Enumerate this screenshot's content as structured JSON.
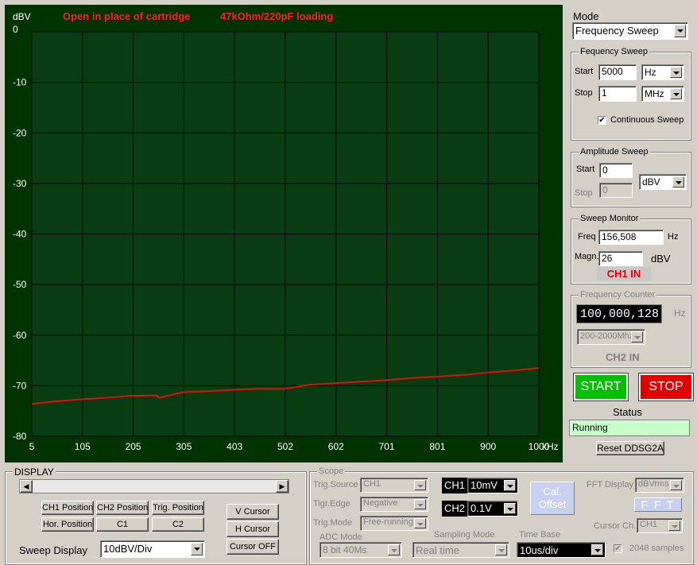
{
  "chart": {
    "title": "Open in place of cartridge",
    "subtitle": "47kOhm/220pF loading",
    "y_unit": "dBV",
    "x_unit": "kHz"
  },
  "chart_data": {
    "type": "line",
    "title": "Open in place of cartridge",
    "ylabel": "dBV",
    "xlabel": "kHz",
    "x_ticks": [
      "5",
      "105",
      "205",
      "305",
      "403",
      "502",
      "602",
      "701",
      "801",
      "900",
      "1000"
    ],
    "y_ticks": [
      "0",
      "-10",
      "-20",
      "-30",
      "-40",
      "-50",
      "-60",
      "-70",
      "-80"
    ],
    "ylim": [
      -80,
      0
    ],
    "xlim": [
      5,
      1000
    ],
    "grid": true,
    "series": [
      {
        "color": "#e01010",
        "x": [
          5,
          50,
          100,
          150,
          200,
          250,
          255,
          300,
          350,
          400,
          450,
          502,
          550,
          600,
          650,
          700,
          750,
          800,
          850,
          900,
          950,
          1000
        ],
        "y": [
          -73.6,
          -73.1,
          -72.7,
          -72.4,
          -72.0,
          -71.9,
          -72.4,
          -71.3,
          -71.1,
          -70.8,
          -70.6,
          -70.6,
          -69.8,
          -69.5,
          -69.2,
          -68.9,
          -68.5,
          -68.2,
          -67.9,
          -67.4,
          -67.0,
          -66.5
        ]
      }
    ]
  },
  "mode": {
    "label": "Mode",
    "value": "Frequency Sweep"
  },
  "freq_sweep": {
    "title": "Fequency Sweep",
    "start_label": "Start",
    "start_value": "5000",
    "start_unit": "Hz",
    "stop_label": "Stop",
    "stop_value": "1",
    "stop_unit": "MHz",
    "continuous_label": "Continuous Sweep",
    "continuous_mark": "✔"
  },
  "amp_sweep": {
    "title": "Amplitude Sweep",
    "start_label": "Start",
    "start_value": "0",
    "stop_label": "Stop",
    "stop_value": "0",
    "unit": "dBV"
  },
  "sweep_monitor": {
    "title": "Sweep Monitor",
    "freq_label": "Freq",
    "freq_value": "156,508",
    "freq_unit": "Hz",
    "magn_label": "Magn.",
    "magn_value": "26",
    "magn_unit": "dBV",
    "channel": "CH1 IN"
  },
  "freq_counter": {
    "title": "Frequency Counter",
    "value": "100,000,128",
    "unit": "Hz",
    "range": "200-2000Mhz",
    "channel": "CH2 IN"
  },
  "controls": {
    "start": "START",
    "stop": "STOP",
    "status_label": "Status",
    "status_value": "Running",
    "reset": "Reset DDSG2A"
  },
  "display": {
    "title": "DISPLAY",
    "ch1_position": "CH1 Position",
    "ch2_position": "CH2 Position",
    "trig_position": "Trig. Position",
    "hor_position": "Hor. Position",
    "c1": "C1",
    "c2": "C2",
    "v_cursor": "V Cursor",
    "h_cursor": "H Cursor",
    "cursor_off": "Cursor OFF",
    "sweep_display_label": "Sweep Display",
    "sweep_display_value": "10dBV/Div"
  },
  "scope": {
    "title": "Scope",
    "trig_source_label": "Trig.Source",
    "trig_source_value": "CH1",
    "trig_edge_label": "Tigr.Edge",
    "trig_edge_value": "Negative",
    "trig_mode_label": "Trig.Mode",
    "trig_mode_value": "Free-running",
    "ch1_label": "CH1",
    "ch1_value": "10mV",
    "ch2_label": "CH2",
    "ch2_value": "0.1V",
    "cal_offset": "Cal. Offset",
    "fft_display_label": "FFT Display",
    "fft_display_value": "dBVrms",
    "fft_button": "F F T",
    "cursor_ch_label": "Cursor Ch.",
    "cursor_ch_value": "CH1",
    "adc_mode_label": "ADC Mode",
    "adc_mode_value": "8 bit 40Ms",
    "sampling_mode_label": "Sampling Mode",
    "sampling_mode_value": "Real time",
    "time_base_label": "Time Base",
    "time_base_value": "10us/div",
    "samples_label": "2048 samples",
    "samples_mark": "✔"
  }
}
